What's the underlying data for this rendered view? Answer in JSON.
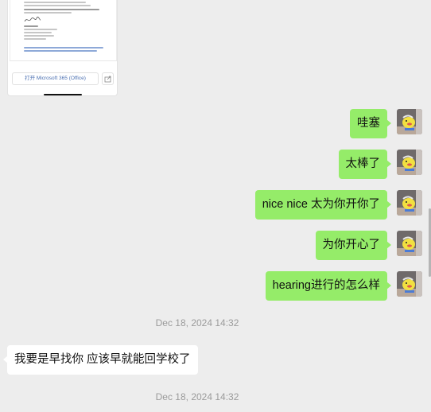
{
  "file_card": {
    "open_button_label": "打开 Microsoft 365 (Office)",
    "share_icon": "share-icon"
  },
  "messages": [
    {
      "side": "sent",
      "text": "哇塞"
    },
    {
      "side": "sent",
      "text": "太棒了"
    },
    {
      "side": "sent",
      "text": "nice nice 太为你开你了"
    },
    {
      "side": "sent",
      "text": "为你开心了"
    },
    {
      "side": "sent",
      "text": "hearing进行的怎么样"
    }
  ],
  "timestamps": [
    "Dec 18, 2024 14:32",
    "Dec 18, 2024 14:32"
  ],
  "received": [
    {
      "side": "received",
      "text": "我要是早找你 应该早就能回学校了"
    }
  ],
  "colors": {
    "background": "#ededed",
    "sent_bubble": "#95ec69",
    "received_bubble": "#ffffff",
    "timestamp_text": "#9b9b9b"
  }
}
